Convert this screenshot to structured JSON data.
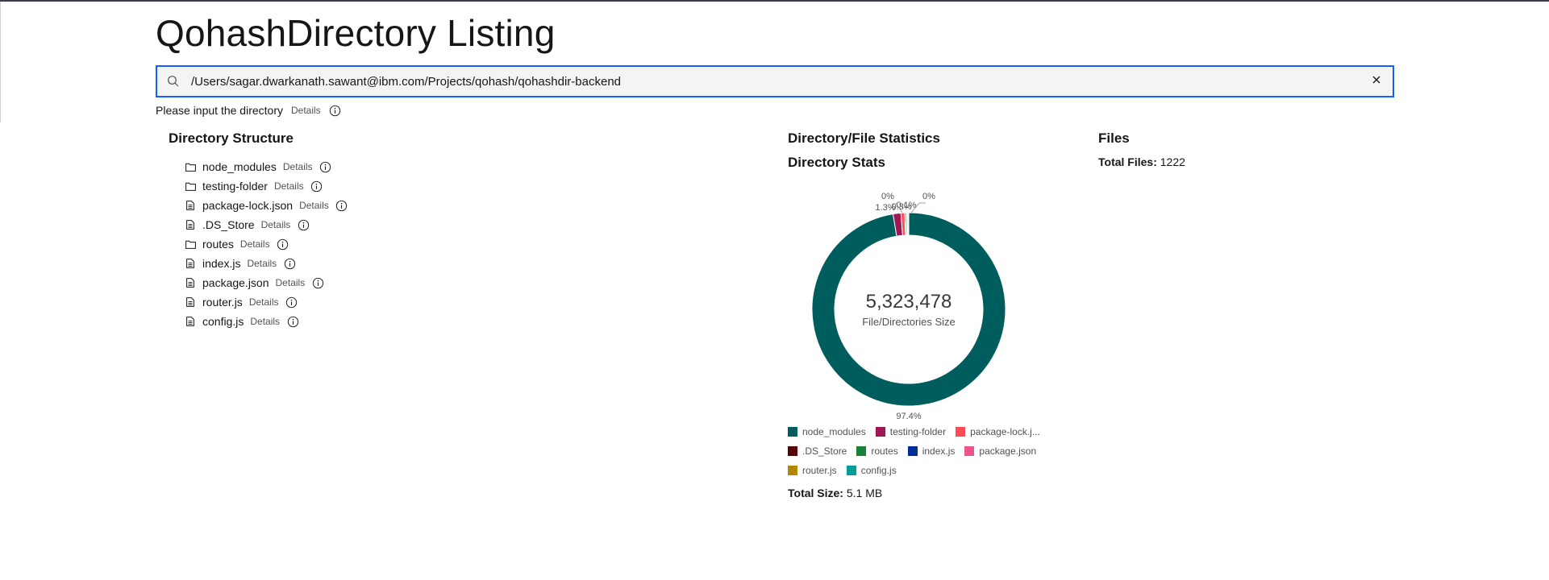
{
  "page": {
    "title": "QohashDirectory Listing"
  },
  "search": {
    "value": "/Users/sagar.dwarkanath.sawant@ibm.com/Projects/qohash/qohashdir-backend",
    "icon": "search-icon",
    "clear_icon": "close-icon"
  },
  "helper": {
    "text": "Please input the directory",
    "details": "Details"
  },
  "sections": {
    "directory_structure": "Directory Structure",
    "statistics": "Directory/File Statistics",
    "directory_stats": "Directory Stats",
    "files": "Files"
  },
  "tree": [
    {
      "name": "node_modules",
      "type": "folder",
      "details": "Details"
    },
    {
      "name": "testing-folder",
      "type": "folder",
      "details": "Details"
    },
    {
      "name": "package-lock.json",
      "type": "file",
      "details": "Details"
    },
    {
      "name": ".DS_Store",
      "type": "file",
      "details": "Details"
    },
    {
      "name": "routes",
      "type": "folder",
      "details": "Details"
    },
    {
      "name": "index.js",
      "type": "file",
      "details": "Details"
    },
    {
      "name": "package.json",
      "type": "file",
      "details": "Details"
    },
    {
      "name": "router.js",
      "type": "file",
      "details": "Details"
    },
    {
      "name": "config.js",
      "type": "file",
      "details": "Details"
    }
  ],
  "files_panel": {
    "label": "Total Files:",
    "value": "1222"
  },
  "chart_data": {
    "type": "pie",
    "donut": true,
    "center_value": "5,323,478",
    "center_label": "File/Directories Size",
    "categories": [
      "node_modules",
      "testing-folder",
      "package-lock.json",
      ".DS_Store",
      "routes",
      "index.js",
      "package.json",
      "router.js",
      "config.js"
    ],
    "legend_labels": [
      "node_modules",
      "testing-folder",
      "package-lock.j...",
      ".DS_Store",
      "routes",
      "index.js",
      "package.json",
      "router.js",
      "config.js"
    ],
    "values": [
      97.4,
      1.3,
      0.6,
      0.2,
      0.2,
      0.1,
      0.1,
      0.05,
      0.05
    ],
    "colors": [
      "#005d5d",
      "#9f1853",
      "#fa4d56",
      "#570408",
      "#198038",
      "#002d9c",
      "#ee538b",
      "#b28600",
      "#009d9a"
    ],
    "slice_labels": [
      {
        "text": "97.4%",
        "anchor": "bottom"
      },
      {
        "text": "1.3%",
        "anchor": "top-left"
      },
      {
        "text": "0%",
        "anchor": "top-left-upper"
      },
      {
        "text": "0%",
        "anchor": "top-right"
      },
      {
        "text": "0.3%",
        "anchor": "top-cluster"
      },
      {
        "text": "0.1%",
        "anchor": "top-cluster"
      }
    ],
    "legend_placement": "bottom"
  },
  "total_size": {
    "label": "Total Size:",
    "value": "5.1 MB"
  }
}
